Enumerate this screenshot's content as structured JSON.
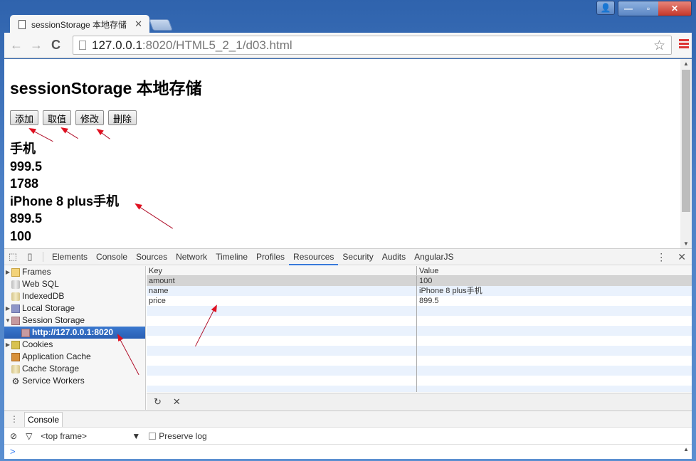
{
  "browser": {
    "tab_title": "sessionStorage 本地存储",
    "url_host": "127.0.0.1",
    "url_rest": ":8020/HTML5_2_1/d03.html"
  },
  "page": {
    "title": "sessionStorage 本地存储",
    "buttons": [
      "添加",
      "取值",
      "修改",
      "删除"
    ],
    "outputs": [
      "手机",
      "999.5",
      "1788",
      "iPhone 8 plus手机",
      "899.5",
      "100"
    ]
  },
  "devtools": {
    "tabs": [
      "Elements",
      "Console",
      "Sources",
      "Network",
      "Timeline",
      "Profiles",
      "Resources",
      "Security",
      "Audits",
      "AngularJS"
    ],
    "active_tab": "Resources",
    "tree": [
      {
        "label": "Frames",
        "icon": "folder-icon",
        "expandable": true
      },
      {
        "label": "Web SQL",
        "icon": "database-icon",
        "expandable": false
      },
      {
        "label": "IndexedDB",
        "icon": "indexeddb-icon",
        "expandable": false
      },
      {
        "label": "Local Storage",
        "icon": "local-storage-icon",
        "expandable": true
      },
      {
        "label": "Session Storage",
        "icon": "session-storage-icon",
        "expanded": true
      },
      {
        "label": "http://127.0.0.1:8020",
        "icon": "storage-origin-icon",
        "selected": true
      },
      {
        "label": "Cookies",
        "icon": "cookie-icon",
        "expandable": true
      },
      {
        "label": "Application Cache",
        "icon": "app-cache-icon",
        "expandable": false
      },
      {
        "label": "Cache Storage",
        "icon": "cache-storage-icon",
        "expandable": false
      },
      {
        "label": "Service Workers",
        "icon": "gear-icon",
        "expandable": false
      }
    ],
    "grid": {
      "headers": [
        "Key",
        "Value"
      ],
      "rows": [
        {
          "key": "amount",
          "value": "100",
          "selected": true
        },
        {
          "key": "name",
          "value": "iPhone 8 plus手机"
        },
        {
          "key": "price",
          "value": "899.5"
        }
      ]
    },
    "drawer_tab": "Console",
    "console": {
      "context": "<top frame>",
      "preserve_log_label": "Preserve log",
      "preserve_log_checked": false,
      "prompt": ">"
    }
  }
}
